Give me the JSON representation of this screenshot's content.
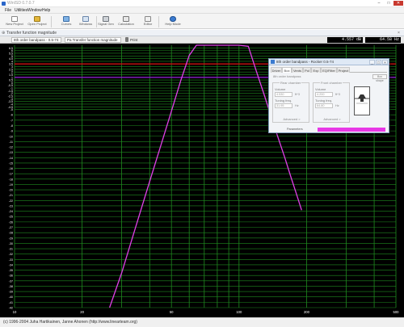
{
  "window": {
    "title": "WinISD 0.7.0.7",
    "minimize": "–",
    "maximize": "□",
    "close": "✕"
  },
  "menu": [
    "File",
    "Utilities",
    "Window",
    "Help"
  ],
  "toolbar": {
    "buttons": [
      {
        "label": "New Project",
        "icon": "new-project-icon"
      },
      {
        "label": "Open Project",
        "icon": "open-project-icon"
      },
      {
        "label": "Curves",
        "icon": "curves-icon"
      },
      {
        "label": "Windows",
        "icon": "windows-icon"
      },
      {
        "label": "Signal Gen",
        "icon": "signal-generator-icon"
      },
      {
        "label": "Calculation",
        "icon": "calculator-icon"
      },
      {
        "label": "Editor",
        "icon": "editor-icon"
      },
      {
        "label": "Help Mode",
        "icon": "help-icon"
      }
    ]
  },
  "tab": {
    "title": "Transfer function magnitude",
    "close": "×"
  },
  "chart_header": {
    "project_select": "8th order bandpass - 0.5-74",
    "graph_select": "Pa Transfer function magnitude",
    "print_label": "Print",
    "readout_db": "4.557 dB",
    "readout_hz": "64.58 Hz"
  },
  "chart_data": {
    "type": "line",
    "xscale": "log",
    "xlim": [
      10,
      500
    ],
    "x_ticks": [
      "10",
      "20",
      "50",
      "100",
      "200",
      "500"
    ],
    "ylim": [
      -42,
      7
    ],
    "y_ticks": [
      "6.5",
      "6",
      "5.5",
      "5",
      "4.5",
      "4",
      "3.5",
      "3",
      "2.5",
      "2",
      "1.5",
      "1",
      "0.5",
      "0",
      "-0.5",
      "-1",
      "-1.5",
      "-2",
      "-2.5",
      "-3",
      "-3.5",
      "-4",
      "-4.5",
      "-5",
      "-6",
      "-7",
      "-8",
      "-9",
      "-10",
      "-11",
      "-12",
      "-13",
      "-14",
      "-15",
      "-16",
      "-17",
      "-18",
      "-19",
      "-20",
      "-21",
      "-22",
      "-23",
      "-24",
      "-25",
      "-26",
      "-27",
      "-28",
      "-29",
      "-30",
      "-31",
      "-32",
      "-33",
      "-34",
      "-35",
      "-36",
      "-37",
      "-38",
      "-39",
      "-40",
      "-41",
      "-42"
    ],
    "grid": true,
    "background": "#000000",
    "grid_color": "#1f8a1f",
    "markers": [
      {
        "y": 3.5,
        "color": "#cc1111"
      },
      {
        "y": 1.0,
        "color": "#8a1fc8"
      }
    ],
    "series": [
      {
        "color": "#e040e8",
        "x": [
          26.5,
          30,
          35,
          40,
          45,
          50,
          55,
          60,
          64.58,
          70,
          80,
          90,
          100,
          110,
          120,
          130,
          140,
          150,
          160,
          170,
          180,
          190
        ],
        "y": [
          -42,
          -35.5,
          -26.3,
          -18.4,
          -11.5,
          -5.3,
          0.4,
          5.1,
          7.0,
          7.0,
          7.0,
          7.0,
          7.0,
          6.8,
          1.9,
          -2.5,
          -6.7,
          -10.5,
          -14.0,
          -17.5,
          -20.7,
          -23.8
        ]
      }
    ]
  },
  "dialog": {
    "title": "8th order bandpass - Rocker 0.5-74",
    "ctl_min": "_",
    "ctl_max": "□",
    "ctl_close": "×",
    "tabs": [
      "Driver",
      "Box",
      "Vents",
      "Pol",
      "Exp",
      "EQ/Filter",
      "Project"
    ],
    "active_tab": "Box",
    "subtitle": "8th order bandpass",
    "show_button": "Box shape",
    "rear_chamber": {
      "title": "Rear chamber",
      "volume_label": "Volume",
      "volume_value": "4.530",
      "volume_unit": "ft^3",
      "tuning_label": "Tuning freq.",
      "tuning_value": "31.95",
      "tuning_unit": "Hz",
      "advanced": "Advanced >"
    },
    "front_chamber": {
      "title": "Front chamber",
      "volume_label": "Volume",
      "volume_value": "4.200",
      "volume_unit": "ft^3",
      "tuning_label": "Tuning freq.",
      "tuning_value": "64.80",
      "tuning_unit": "Hz",
      "advanced": "Advanced >"
    },
    "progress_label": "Parameters",
    "progress_value": 1.0,
    "progress_color": "#e838e6"
  },
  "status": {
    "text": "(c) 1996-2004 Juha Hartikainen, Janne Ahonen (http://www.linearteam.org)"
  }
}
